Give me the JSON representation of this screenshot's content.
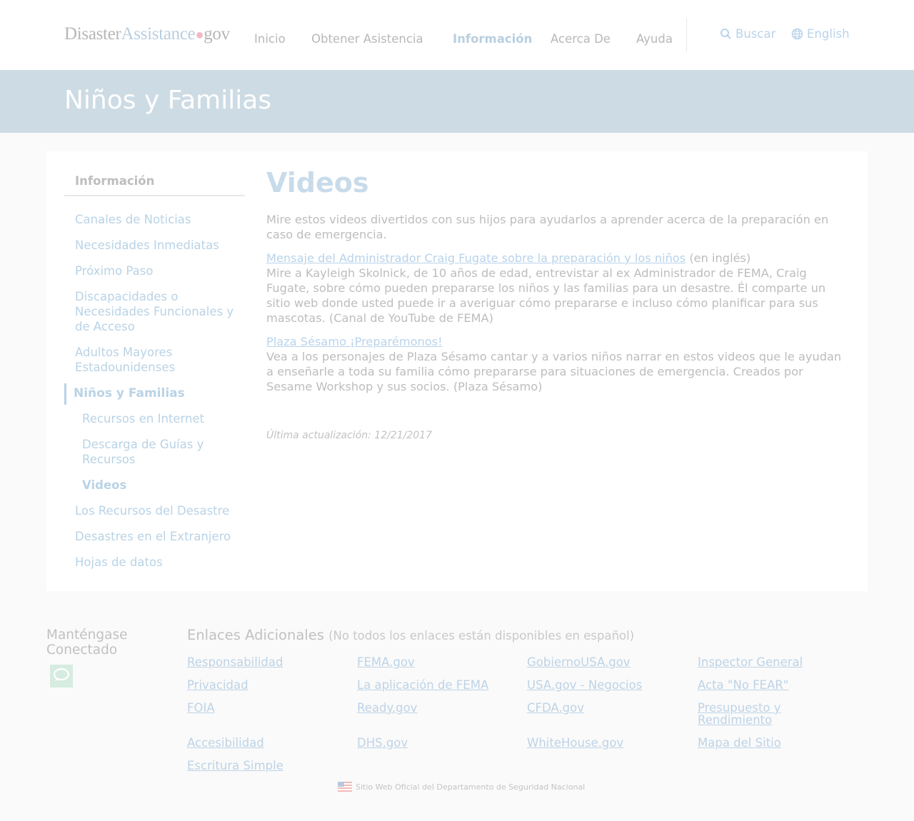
{
  "header": {
    "logo": {
      "part1": "Disaster",
      "part2": "Assistance",
      "dot": "●",
      "part3": "gov"
    },
    "nav": [
      {
        "label": "Inicio"
      },
      {
        "label": "Obtener Asistencia"
      },
      {
        "label": "Información",
        "active": true
      },
      {
        "label": "Acerca De"
      },
      {
        "label": "Ayuda"
      }
    ],
    "search_label": "Buscar",
    "search_icon": "search-icon",
    "language_label": "English",
    "language_icon": "globe-icon"
  },
  "banner": {
    "title": "Niños y Familias"
  },
  "sidebar": {
    "heading": "Información",
    "items": [
      {
        "label": "Canales de Noticias"
      },
      {
        "label": "Necesidades Inmediatas"
      },
      {
        "label": "Próximo Paso"
      },
      {
        "label": "Discapacidades o Necesidades Funcionales y de Acceso"
      },
      {
        "label": "Adultos Mayores Estadounidenses"
      },
      {
        "label": "Niños y Familias",
        "active": true
      },
      {
        "label": "Recursos en Internet"
      },
      {
        "label": "Descarga de Guías y Recursos"
      },
      {
        "label": "Videos",
        "current": true
      },
      {
        "label": "Los Recursos del Desastre"
      },
      {
        "label": "Desastres en el Extranjero"
      },
      {
        "label": "Hojas de datos"
      }
    ]
  },
  "main": {
    "title": "Videos",
    "intro": "Mire estos videos divertidos con sus hijos para ayudarlos a aprender acerca de la preparación en caso de emergencia.",
    "videos": [
      {
        "link": "Mensaje del Administrador Craig Fugate sobre la preparación y los niños",
        "note": " (en inglés)",
        "description": "Mire a Kayleigh Skolnick, de 10 años de edad, entrevistar al ex Administrador de FEMA, Craig Fugate, sobre cómo pueden prepararse los niños y las familias para un desastre. Él comparte un sitio web donde usted puede ir a averiguar cómo prepararse e incluso cómo planificar para sus mascotas. (Canal de YouTube de FEMA)"
      },
      {
        "link": "Plaza Sésamo ¡Preparémonos!",
        "description": "Vea a los personajes de Plaza Sésamo cantar y a varios niños narrar en estos videos que le ayudan a enseñarle a toda su familia cómo prepararse para situaciones de emergencia. Creados por Sesame Workshop y sus socios. (Plaza Sésamo)"
      }
    ],
    "updated": "Última actualización: 12/21/2017"
  },
  "footer": {
    "stay_connected": "Manténgase Conectado",
    "chat_icon": "chat-bubble-icon",
    "links_heading": "Enlaces Adicionales",
    "links_note": "(No todos los enlaces están disponibles en español)",
    "links": [
      [
        "Responsabilidad",
        "FEMA.gov",
        "GobiernoUSA.gov",
        "Inspector General"
      ],
      [
        "Privacidad",
        "La aplicación de FEMA",
        "USA.gov - Negocios",
        "Acta \"No FEAR\""
      ],
      [
        "FOIA",
        "Ready.gov",
        "CFDA.gov",
        "Presupuesto y Rendimiento"
      ],
      [
        "Accesibilidad",
        "DHS.gov",
        "WhiteHouse.gov",
        "Mapa del Sitio"
      ],
      [
        "Escritura Simple"
      ]
    ],
    "official_site": "Sitio Web Oficial del Departamento de Seguridad Nacional",
    "flag_icon": "us-flag-icon"
  }
}
